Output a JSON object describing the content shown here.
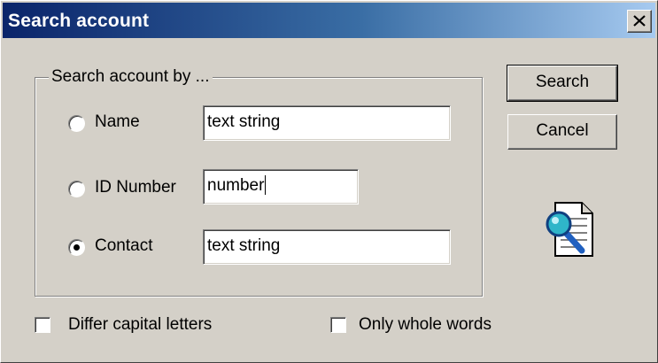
{
  "window": {
    "title": "Search account",
    "close_icon": "close-icon"
  },
  "group": {
    "legend": "Search account by ..."
  },
  "options": [
    {
      "label": "Name",
      "value": "text string",
      "selected": false
    },
    {
      "label": "ID Number",
      "value": "number",
      "selected": false
    },
    {
      "label": "Contact",
      "value": "text string",
      "selected": true
    }
  ],
  "buttons": {
    "search_label": "Search",
    "cancel_label": "Cancel"
  },
  "checkboxes": [
    {
      "label": "Differ capital letters",
      "checked": false
    },
    {
      "label": "Only whole words",
      "checked": false
    }
  ],
  "icons": {
    "search_document": "document-search-icon"
  },
  "colors": {
    "face": "#d4d0c8",
    "title_start": "#0a246a",
    "title_end": "#a6caf0"
  }
}
